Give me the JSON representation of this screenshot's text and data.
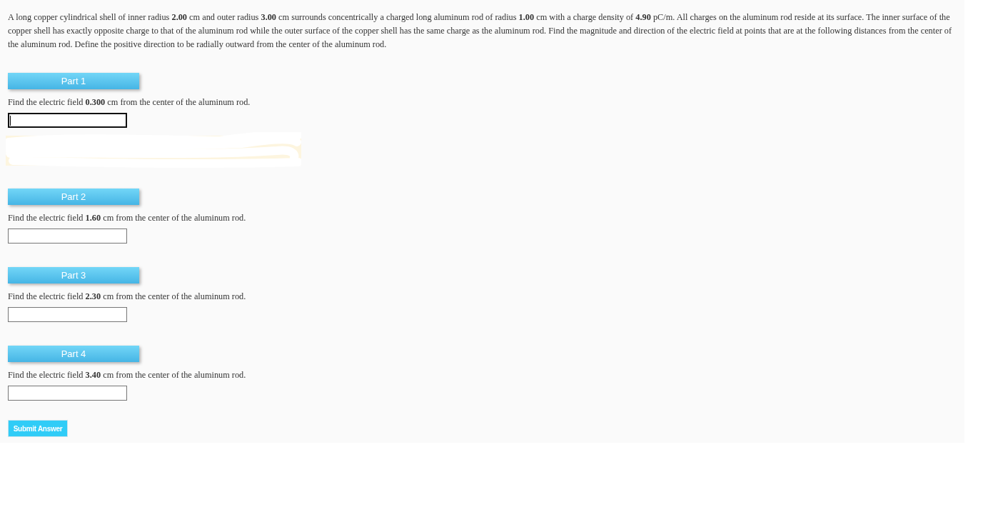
{
  "problem": {
    "text": "A long copper cylindrical shell of inner radius **2.00** cm and outer radius **3.00** cm surrounds concentrically a charged long aluminum rod of radius **1.00** cm with a charge density of **4.90** pC/m. All charges on the aluminum rod reside at its surface. The inner surface of the copper shell has exactly opposite charge to that of the aluminum rod while the outer surface of the copper shell has the same charge as the aluminum rod. Find the magnitude and direction of the electric field at points that are at the following distances from the center of the aluminum rod. Define the positive direction to be radially outward from the center of the aluminum rod."
  },
  "parts": [
    {
      "label": "Part 1",
      "prompt": "Find the electric field **0.300** cm from the center of the aluminum rod.",
      "answer": {
        "focused": true
      },
      "scribbled_out": true
    },
    {
      "label": "Part 2",
      "prompt": "Find the electric field **1.60** cm from the center of the aluminum rod.",
      "answer": {
        "focused": false
      },
      "scribbled_out": false
    },
    {
      "label": "Part 3",
      "prompt": "Find the electric field **2.30** cm from the center of the aluminum rod.",
      "answer": {
        "focused": false
      },
      "scribbled_out": false
    },
    {
      "label": "Part 4",
      "prompt": "Find the electric field **3.40** cm from the center of the aluminum rod.",
      "answer": {
        "focused": false
      },
      "scribbled_out": false
    }
  ],
  "submit_button": {
    "label": "Submit Answer"
  }
}
